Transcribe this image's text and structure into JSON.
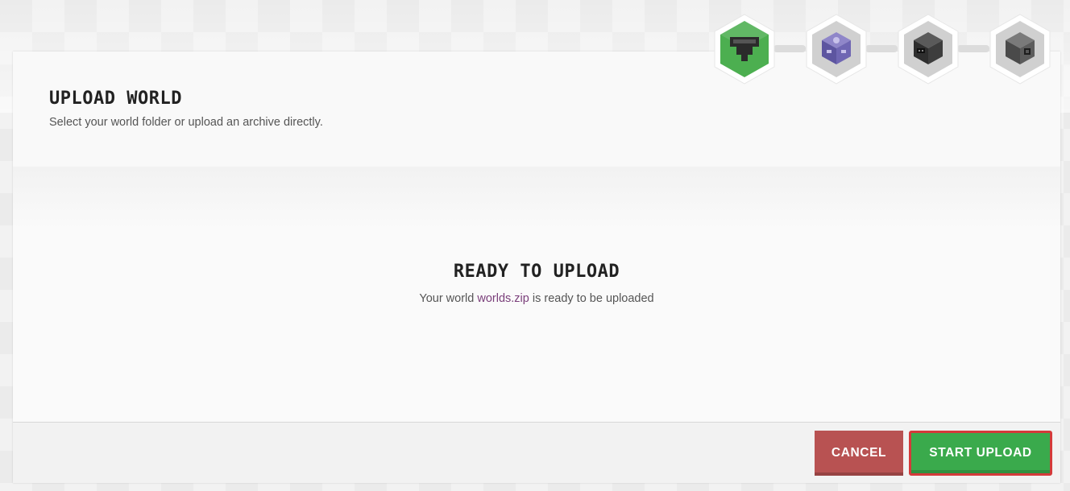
{
  "page": {
    "title": "UPLOAD WORLD",
    "subtitle": "Select your world folder or upload an archive directly."
  },
  "status": {
    "title": "READY TO UPLOAD",
    "text_before": "Your world ",
    "filename": "worlds.zip",
    "text_after": " is ready to be uploaded"
  },
  "footer": {
    "cancel_label": "CANCEL",
    "start_label": "START UPLOAD"
  },
  "steps": [
    {
      "icon": "hopper-icon",
      "active": true
    },
    {
      "icon": "command-block-icon",
      "active": false
    },
    {
      "icon": "furnace-icon",
      "active": false
    },
    {
      "icon": "dispenser-icon",
      "active": false
    }
  ],
  "colors": {
    "step_active": "#4caf50",
    "step_inactive": "#d0d0d0",
    "cancel": "#b85252",
    "start": "#3aaa4c",
    "start_outline": "#d43a3a",
    "filename": "#7a3e7a"
  }
}
